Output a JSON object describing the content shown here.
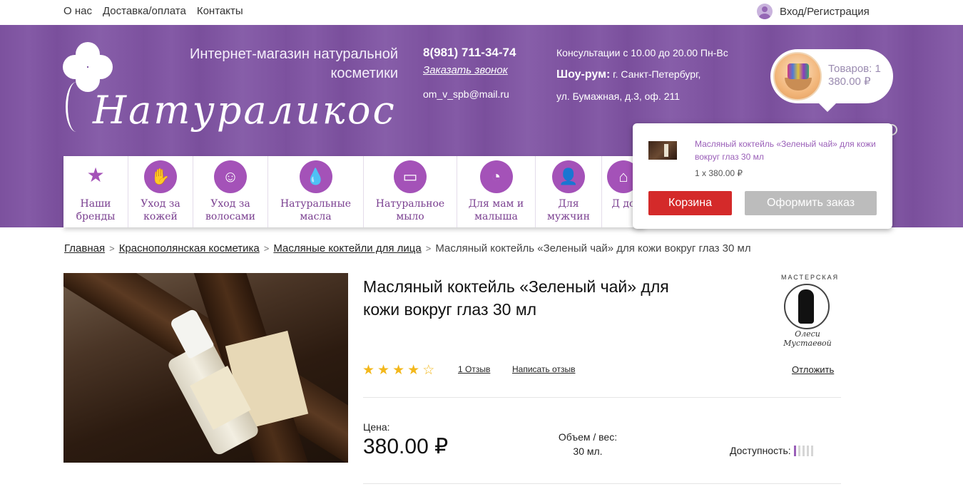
{
  "topnav": {
    "about": "О нас",
    "delivery": "Доставка/оплата",
    "contacts": "Контакты",
    "login": "Вход/Регистрация"
  },
  "header": {
    "logo_text": "Натураликос",
    "tagline": "Интернет-магазин натуральной косметики",
    "phone": "8(981) 711-34-74",
    "callback": "Заказать звонок",
    "email": "om_v_spb@mail.ru",
    "consult": "Консультации с 10.00 до 20.00 Пн-Вс",
    "showroom_label": "Шоу-рум:",
    "showroom_city": " г. Санкт-Петербург,",
    "address": "ул. Бумажная, д.3, оф. 211",
    "cart_count": "Товаров: 1",
    "cart_sum": "380.00 ₽"
  },
  "categories": [
    {
      "label": "Наши бренды",
      "icon": "star-icon"
    },
    {
      "label": "Уход за кожей",
      "icon": "hand-icon"
    },
    {
      "label": "Уход за волосами",
      "icon": "hair-icon"
    },
    {
      "label": "Натуральные масла",
      "icon": "drops-icon"
    },
    {
      "label": "Натуральное мыло",
      "icon": "soap-icon"
    },
    {
      "label": "Для мам и малыша",
      "icon": "duck-icon"
    },
    {
      "label": "Для мужчин",
      "icon": "man-icon"
    },
    {
      "label": "Д до",
      "icon": "house-icon"
    }
  ],
  "cart_dropdown": {
    "item_name": "Масляный коктейль «Зеленый чай» для кожи вокруг глаз 30 мл",
    "qty": "1 x 380.00 ₽",
    "cart_button": "Корзина",
    "order_button": "Оформить заказ"
  },
  "breadcrumbs": [
    "Главная",
    "Краснополянская косметика",
    "Масляные коктейли для лица",
    "Масляный коктейль «Зеленый чай» для кожи вокруг глаз 30 мл"
  ],
  "breadcrumb_separator": ">",
  "product": {
    "title": "Масляный коктейль «Зеленый чай» для кожи вокруг глаз 30 мл",
    "brand_top": "МАСТЕРСКАЯ",
    "brand_bottom": "Олеси Мустаевой",
    "rating": 4,
    "rating_max": 5,
    "reviews": "1 Отзыв",
    "write_review": "Написать отзыв",
    "postpone": "Отложить",
    "price_label": "Цена:",
    "price": "380.00 ₽",
    "volume_label": "Объем / вес:",
    "volume": "30 мл.",
    "availability_label": "Доступность:",
    "availability_level": 1,
    "availability_max": 5
  },
  "colors": {
    "brand_purple": "#7e53a0",
    "accent_violet": "#a452b8",
    "cart_red": "#d42a2a",
    "star": "#f3b81c"
  }
}
